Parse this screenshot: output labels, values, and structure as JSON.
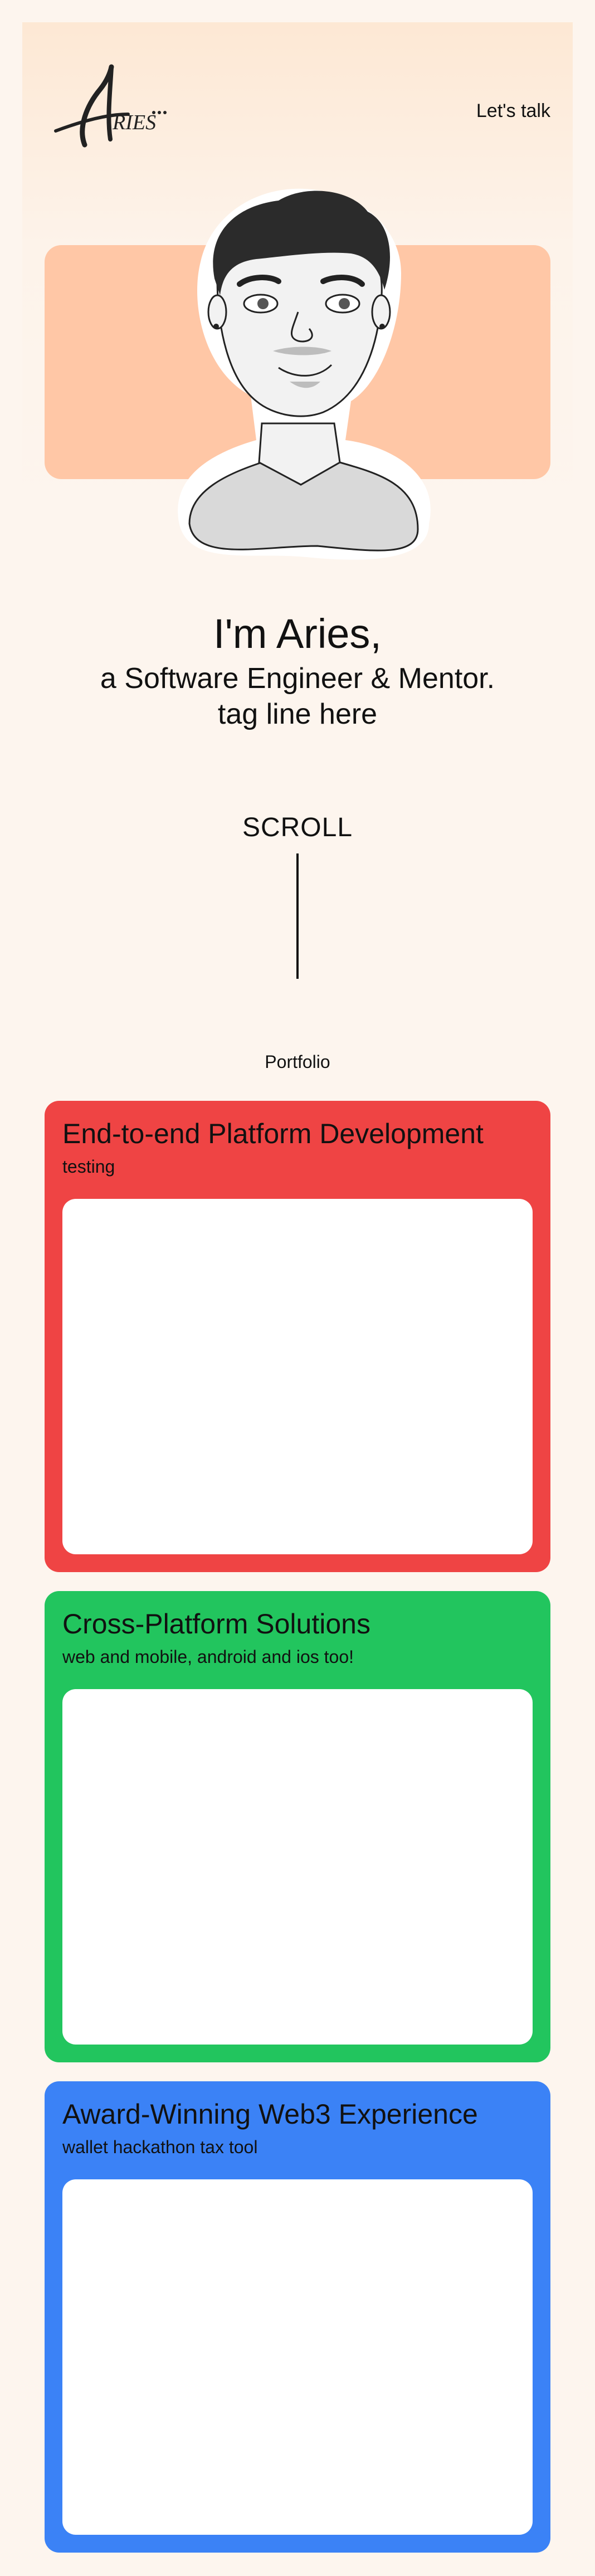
{
  "header": {
    "logo_text": "Aries",
    "cta_label": "Let's talk"
  },
  "hero": {
    "greeting": "I'm Aries,",
    "role": "a Software Engineer & Mentor.",
    "tagline": "tag line here",
    "accent_color": "#ffc7a6"
  },
  "scroll": {
    "label": "SCROLL"
  },
  "portfolio": {
    "title": "Portfolio",
    "cards": [
      {
        "title": "End-to-end Platform Development",
        "subtitle": "testing",
        "color": "#ef4444"
      },
      {
        "title": "Cross-Platform Solutions",
        "subtitle": "web and mobile, android and ios too!",
        "color": "#22c55e"
      },
      {
        "title": "Award-Winning Web3 Experience",
        "subtitle": "wallet hackathon tax tool",
        "color": "#3b82f6"
      }
    ]
  }
}
